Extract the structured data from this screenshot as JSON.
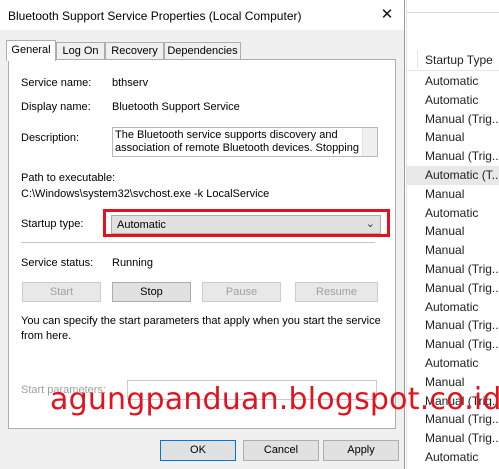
{
  "dialog": {
    "title": "Bluetooth Support Service Properties (Local Computer)",
    "close_glyph": "✕",
    "tabs": [
      {
        "label": "General",
        "active": true
      },
      {
        "label": "Log On"
      },
      {
        "label": "Recovery"
      },
      {
        "label": "Dependencies"
      }
    ],
    "general": {
      "service_name_label": "Service name:",
      "service_name_value": "bthserv",
      "display_name_label": "Display name:",
      "display_name_value": "Bluetooth Support Service",
      "description_label": "Description:",
      "description_line1": "The Bluetooth service supports discovery and",
      "description_line2": "association of remote Bluetooth devices.  Stopping",
      "path_label": "Path to executable:",
      "path_value": "C:\\Windows\\system32\\svchost.exe -k LocalService",
      "startup_type_label": "Startup type:",
      "startup_type_value": "Automatic",
      "service_status_label": "Service status:",
      "service_status_value": "Running",
      "buttons": {
        "start": "Start",
        "stop": "Stop",
        "pause": "Pause",
        "resume": "Resume"
      },
      "help_text_line1": "You can specify the start parameters that apply when you start the service",
      "help_text_line2": "from here.",
      "start_params_label": "Start parameters:"
    },
    "footer": {
      "ok": "OK",
      "cancel": "Cancel",
      "apply": "Apply"
    },
    "highlight_color": "#e2131f"
  },
  "background_list": {
    "header": "Startup Type",
    "rows": [
      "Automatic",
      "Automatic",
      "Manual (Trig...",
      "Manual",
      "Manual (Trig...",
      "Automatic (T...",
      "Manual",
      "Automatic",
      "Manual",
      "Manual",
      "Manual (Trig...",
      "Manual (Trig...",
      "Automatic",
      "Manual (Trig...",
      "Manual (Trig...",
      "Automatic",
      "Manual",
      "Manual (Trig...",
      "Manual (Trig...",
      "Manual (Trig...",
      "Automatic"
    ]
  },
  "watermark": "agungpanduan.blogspot.co.id"
}
